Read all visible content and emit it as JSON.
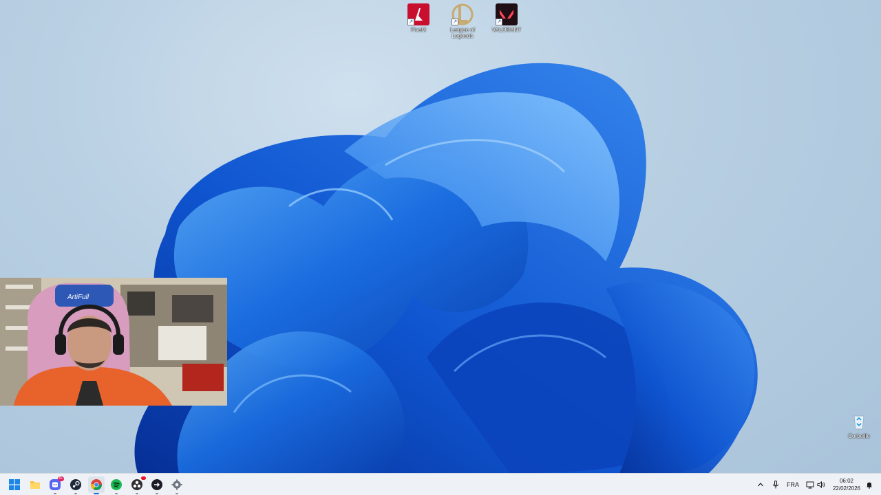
{
  "desktop": {
    "icons": [
      {
        "label": "FiveM",
        "icon": "fivem-icon",
        "color": "#c8102e"
      },
      {
        "label": "League of Legends",
        "icon": "league-of-legends-icon",
        "color": "#c8aa6e"
      },
      {
        "label": "VALORANT",
        "icon": "valorant-icon",
        "color": "#fd4556"
      }
    ],
    "recycle_bin": {
      "label": "Corbeille",
      "icon": "recycle-bin-icon"
    }
  },
  "webcam": {
    "chair_brand": "ArtiFull"
  },
  "taskbar": {
    "apps": [
      {
        "name": "Start",
        "icon": "windows-start-icon"
      },
      {
        "name": "File Explorer",
        "icon": "folder-icon"
      },
      {
        "name": "Discord",
        "icon": "discord-icon",
        "badge": "9+"
      },
      {
        "name": "Steam",
        "icon": "steam-icon"
      },
      {
        "name": "Google Chrome",
        "icon": "chrome-icon"
      },
      {
        "name": "Spotify",
        "icon": "spotify-icon"
      },
      {
        "name": "OBS Studio",
        "icon": "obs-icon"
      },
      {
        "name": "App",
        "icon": "arrow-app-icon"
      },
      {
        "name": "Settings",
        "icon": "gear-icon"
      }
    ],
    "tray": {
      "chevron": "chevron-up-icon",
      "mic": "microphone-icon",
      "language": "FRA",
      "network": "network-icon",
      "volume": "volume-icon",
      "notification": "notification-icon"
    },
    "clock": {
      "time": "06:02",
      "date": "22/02/2026"
    }
  },
  "colors": {
    "accent": "#1a6de0",
    "taskbar_bg": "#eef1f6",
    "desktop_bg": "#b9d0e3"
  }
}
